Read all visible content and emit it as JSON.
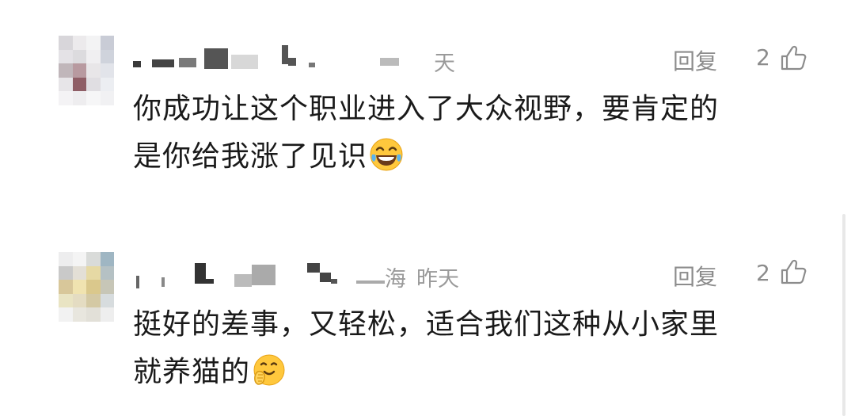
{
  "comments": [
    {
      "date": "天",
      "reply_label": "回复",
      "likes": "2",
      "text_line1": "你成功让这个职业进入了大众视野，要肯定的",
      "text_line2": "是你给我涨了见识",
      "emoji": "laughing-tears-emoji",
      "avatar_colors": [
        "#d8d6da",
        "#eceaec",
        "#f3f3f4",
        "#c9ccd6",
        "#e4e2e6",
        "#dcdbde",
        "#f0eff1",
        "#cfd3dc",
        "#c0b6ba",
        "#b89aa0",
        "#e8e6e8",
        "#e2e4ea",
        "#e7e5e8",
        "#8f5e66",
        "#e0dee2",
        "#eceef2",
        "#f4f3f5",
        "#eeedef",
        "#f6f6f7",
        "#f1f1f3"
      ]
    },
    {
      "date": "昨天",
      "location_fragment": "海",
      "reply_label": "回复",
      "likes": "2",
      "text_line1": "挺好的差事，又轻松，适合我们这种从小家里",
      "text_line2": "就养猫的",
      "emoji": "hugging-face-emoji",
      "avatar_colors": [
        "#ededee",
        "#f4f4f4",
        "#d9dbd9",
        "#9fb6c3",
        "#c9c9c9",
        "#e3dfd6",
        "#e6d9a4",
        "#b5c1c4",
        "#d8c79a",
        "#f0e3b0",
        "#dac88c",
        "#c7c6b7",
        "#e9e4c3",
        "#e4dcc2",
        "#d4c9a4",
        "#d7dcde",
        "#f2f2f2",
        "#e8e6de",
        "#e2e0d8",
        "#eeeeee"
      ]
    }
  ]
}
